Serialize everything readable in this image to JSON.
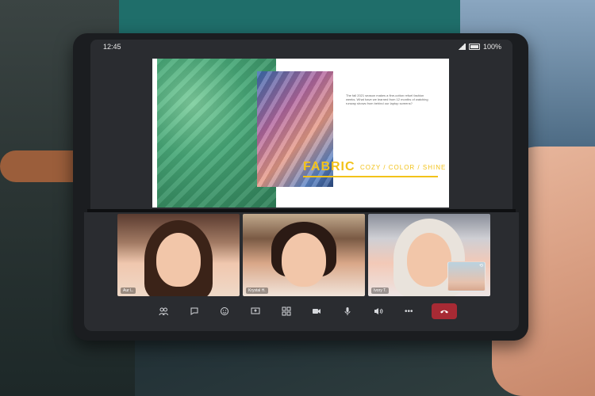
{
  "status_bar": {
    "time": "12:45",
    "battery": "100%"
  },
  "slide": {
    "title": "FABRIC",
    "subtitle": "COZY / COLOR / SHINE",
    "body_text": "The fall 2021 season makes a fine-cotton refuel fashion weeks. What have we learned from 12 months of watching runway shows from behind our laptop screens?",
    "accent_color": "#f2c21a"
  },
  "participants": [
    {
      "name": "Aur L."
    },
    {
      "name": "Krystal H."
    },
    {
      "name": "Ivory T."
    }
  ],
  "toolbar": {
    "icons": [
      "participants-icon",
      "chat-icon",
      "reactions-icon",
      "share-screen-icon",
      "layout-icon",
      "camera-icon",
      "microphone-icon",
      "speaker-icon",
      "more-icon",
      "end-call-icon"
    ],
    "end_call_color": "#a72a34",
    "more_label": "•••"
  }
}
